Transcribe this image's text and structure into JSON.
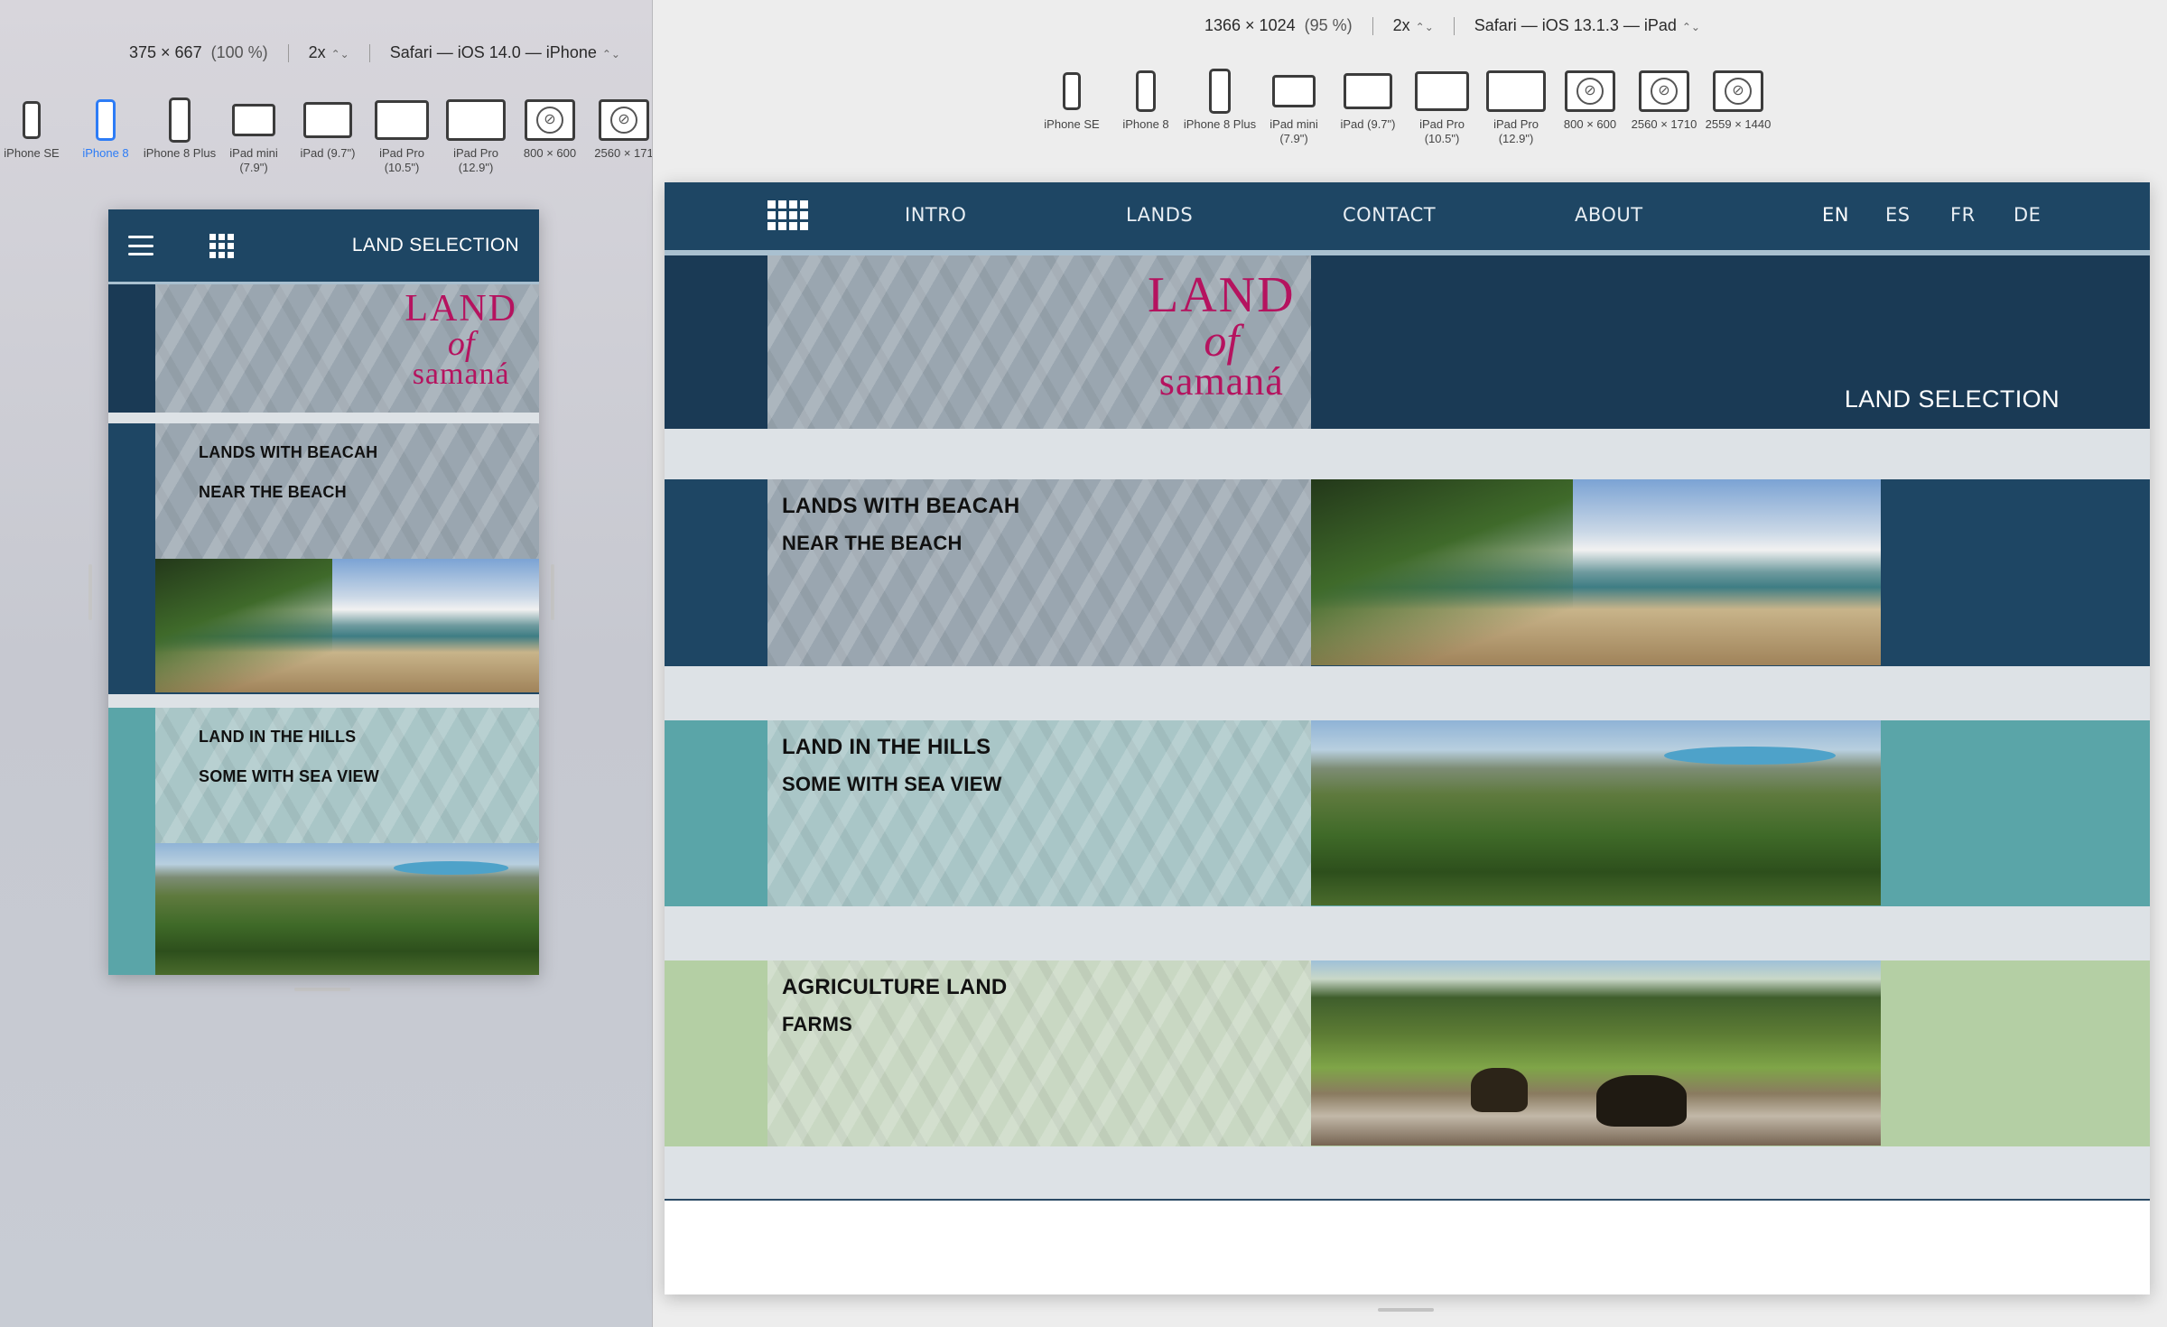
{
  "left_toolbar": {
    "size": "375 × 667",
    "zoom": "(100 %)",
    "scale": "2x",
    "browser": "Safari — iOS 14.0 — iPhone"
  },
  "left_devices": [
    {
      "label": "iPhone SE",
      "kind": "phone"
    },
    {
      "label": "iPhone 8",
      "kind": "phone",
      "active": true
    },
    {
      "label": "iPhone 8 Plus",
      "kind": "phone"
    },
    {
      "label": "iPad mini (7.9\")",
      "kind": "tablet"
    },
    {
      "label": "iPad (9.7\")",
      "kind": "tablet"
    },
    {
      "label": "iPad Pro (10.5\")",
      "kind": "tablet"
    },
    {
      "label": "iPad Pro (12.9\")",
      "kind": "tablet"
    },
    {
      "label": "800 × 600",
      "kind": "compass"
    },
    {
      "label": "2560 × 171",
      "kind": "compass"
    }
  ],
  "right_toolbar": {
    "size": "1366 × 1024",
    "zoom": "(95 %)",
    "scale": "2x",
    "browser": "Safari — iOS 13.1.3 — iPad"
  },
  "right_devices": [
    {
      "label": "iPhone SE",
      "kind": "phone"
    },
    {
      "label": "iPhone 8",
      "kind": "phone"
    },
    {
      "label": "iPhone 8 Plus",
      "kind": "phone"
    },
    {
      "label": "iPad mini (7.9\")",
      "kind": "tablet"
    },
    {
      "label": "iPad (9.7\")",
      "kind": "tablet"
    },
    {
      "label": "iPad Pro (10.5\")",
      "kind": "tablet"
    },
    {
      "label": "iPad Pro (12.9\")",
      "kind": "tablet"
    },
    {
      "label": "800 × 600",
      "kind": "compass"
    },
    {
      "label": "2560 × 1710",
      "kind": "compass"
    },
    {
      "label": "2559 × 1440",
      "kind": "compass"
    }
  ],
  "site": {
    "page_title": "LAND SELECTION",
    "logo": {
      "line1": "LAND",
      "line2": "of",
      "line3": "samaná"
    },
    "nav": [
      "INTRO",
      "LANDS",
      "CONTACT",
      "ABOUT"
    ],
    "languages": [
      "EN",
      "ES",
      "FR",
      "DE"
    ],
    "active_language": "EN",
    "sections": [
      {
        "title": "LANDS WITH BEACAH",
        "subtitle": "NEAR THE BEACH",
        "image": "beach"
      },
      {
        "title": "LAND IN THE HILLS",
        "subtitle": "SOME WITH SEA VIEW",
        "image": "hills"
      },
      {
        "title": "AGRICULTURE LAND",
        "subtitle": "FARMS",
        "image": "fields"
      }
    ]
  },
  "colors": {
    "header": "#1e4664",
    "hero": "#1a3a55",
    "beach_band": "#1e4664",
    "hills_band": "#5aa5a8",
    "farm_band": "#b4cfa4",
    "logo": "#b5135f",
    "active_device": "#2d7cf6"
  }
}
